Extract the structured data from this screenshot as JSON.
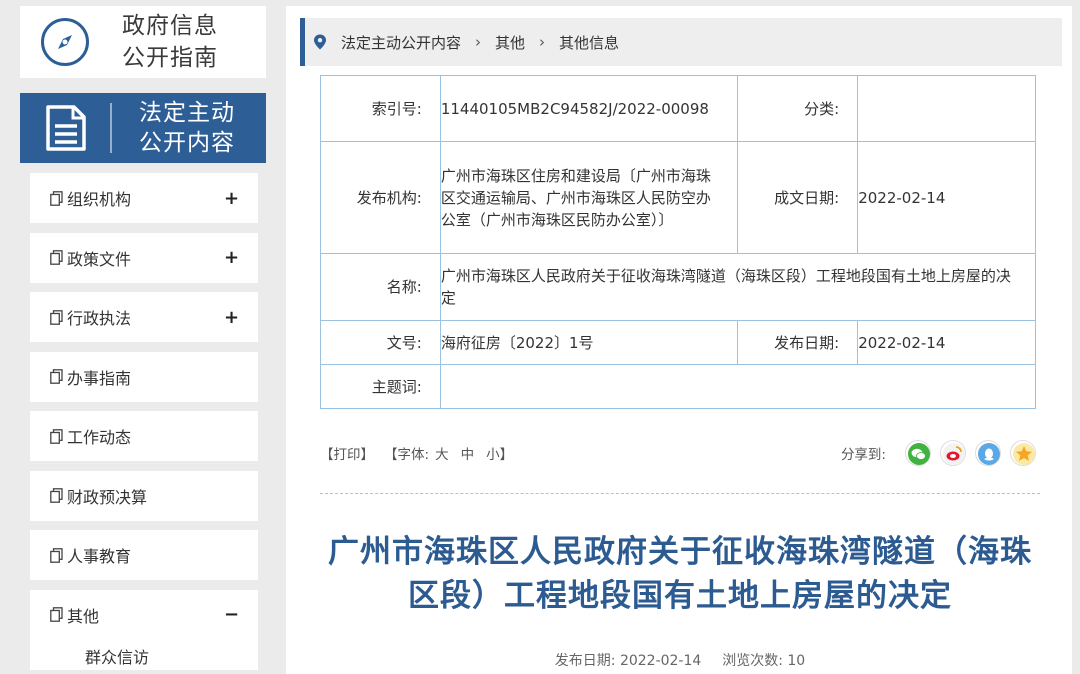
{
  "guide": {
    "title_line1": "政府信息",
    "title_line2": "公开指南",
    "icon": "compass-icon"
  },
  "legal": {
    "title_line1": "法定主动",
    "title_line2": "公开内容",
    "icon": "document-icon"
  },
  "nav": {
    "items": [
      {
        "label": "组织机构",
        "toggle": "+"
      },
      {
        "label": "政策文件",
        "toggle": "+"
      },
      {
        "label": "行政执法",
        "toggle": "+"
      },
      {
        "label": "办事指南",
        "toggle": ""
      },
      {
        "label": "工作动态",
        "toggle": ""
      },
      {
        "label": "财政预决算",
        "toggle": ""
      },
      {
        "label": "人事教育",
        "toggle": ""
      },
      {
        "label": "其他",
        "toggle": "−"
      }
    ],
    "sub_item": "群众信访"
  },
  "breadcrumb": {
    "items": [
      "法定主动公开内容",
      "其他",
      "其他信息"
    ],
    "separator": "›"
  },
  "meta": {
    "index_label": "索引号:",
    "index_value": "11440105MB2C94582J/2022-00098",
    "category_label": "分类:",
    "category_value": "",
    "publisher_label": "发布机构:",
    "publisher_value": "广州市海珠区住房和建设局〔广州市海珠区交通运输局、广州市海珠区人民防空办公室（广州市海珠区民防办公室）〕",
    "created_label": "成文日期:",
    "created_value": "2022-02-14",
    "name_label": "名称:",
    "name_value": "广州市海珠区人民政府关于征收海珠湾隧道（海珠区段）工程地段国有土地上房屋的决定",
    "docno_label": "文号:",
    "docno_value": "海府征房〔2022〕1号",
    "pubdate_label": "发布日期:",
    "pubdate_value": "2022-02-14",
    "subject_label": "主题词:",
    "subject_value": ""
  },
  "tools": {
    "print": "【打印】",
    "font_prefix": "【字体:",
    "font_large": "大",
    "font_medium": "中",
    "font_small": "小",
    "font_suffix": "】",
    "share_label": "分享到:",
    "share_icons": [
      "wechat-icon",
      "weibo-icon",
      "qq-icon",
      "qzone-icon"
    ]
  },
  "article": {
    "title_line1": "广州市海珠区人民政府关于征收海珠湾隧道（海珠",
    "title_line2": "区段）工程地段国有土地上房屋的决定",
    "pub_date_label": "发布日期:",
    "pub_date": "2022-02-14",
    "views_label": "浏览次数:",
    "views": "10"
  },
  "colors": {
    "brand": "#2d5e96",
    "title": "#2c5b92",
    "table_border": "#9bc2e0",
    "background": "#ebebeb"
  }
}
